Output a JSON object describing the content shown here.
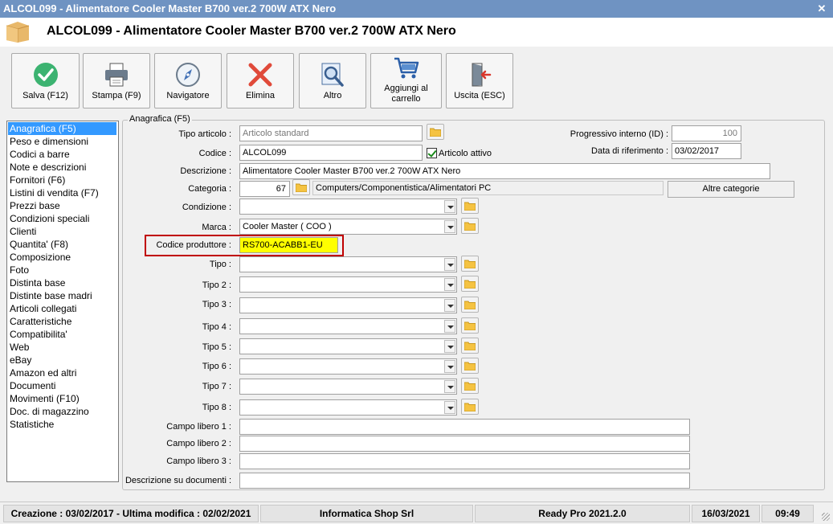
{
  "window": {
    "title": "ALCOL099 - Alimentatore Cooler Master B700 ver.2 700W ATX Nero"
  },
  "header": {
    "title": "ALCOL099 - Alimentatore Cooler Master B700 ver.2 700W ATX Nero"
  },
  "toolbar": {
    "save": "Salva (F12)",
    "print": "Stampa (F9)",
    "navigator": "Navigatore",
    "delete": "Elimina",
    "other": "Altro",
    "add_cart_1": "Aggiungi al",
    "add_cart_2": "carrello",
    "exit": "Uscita (ESC)"
  },
  "sidebar": {
    "items": [
      "Anagrafica (F5)",
      "Peso e dimensioni",
      "Codici a barre",
      "Note e descrizioni",
      "Fornitori (F6)",
      "Listini di vendita (F7)",
      "Prezzi base",
      "Condizioni speciali",
      "Clienti",
      "Quantita' (F8)",
      "Composizione",
      "Foto",
      "Distinta base",
      "Distinte base madri",
      "Articoli collegati",
      "Caratteristiche",
      "Compatibilita'",
      "Web",
      "eBay",
      "Amazon ed altri",
      "Documenti",
      "Movimenti (F10)",
      "Doc. di magazzino",
      "Statistiche"
    ],
    "selected": "Anagrafica (F5)"
  },
  "form": {
    "group_title": "Anagrafica (F5)",
    "tipo_articolo_label": "Tipo articolo :",
    "tipo_articolo_value": "Articolo standard",
    "codice_label": "Codice :",
    "codice_value": "ALCOL099",
    "articolo_attivo_label": "Articolo attivo",
    "descrizione_label": "Descrizione :",
    "descrizione_value": "Alimentatore Cooler Master B700 ver.2 700W ATX Nero",
    "categoria_label": "Categoria :",
    "categoria_id": "67",
    "categoria_path": "Computers/Componentistica/Alimentatori PC",
    "altre_categorie": "Altre categorie",
    "progressivo_label": "Progressivo interno (ID) :",
    "progressivo_value": "100",
    "data_rif_label": "Data di riferimento :",
    "data_rif_value": "03/02/2017",
    "condizione_label": "Condizione :",
    "marca_label": "Marca :",
    "marca_value": "Cooler Master ( COO )",
    "codice_produttore_label": "Codice produttore :",
    "codice_produttore_value": "RS700-ACABB1-EU",
    "tipo_label": "Tipo :",
    "tipo2_label": "Tipo 2 :",
    "tipo3_label": "Tipo 3 :",
    "tipo4_label": "Tipo 4 :",
    "tipo5_label": "Tipo 5 :",
    "tipo6_label": "Tipo 6 :",
    "tipo7_label": "Tipo 7 :",
    "tipo8_label": "Tipo 8 :",
    "campo1_label": "Campo libero 1 :",
    "campo2_label": "Campo libero 2 :",
    "campo3_label": "Campo libero 3 :",
    "desc_doc_label": "Descrizione su documenti :"
  },
  "status": {
    "dates": "Creazione : 03/02/2017 - Ultima modifica : 02/02/2021",
    "company": "Informatica Shop Srl",
    "app": "Ready Pro 2021.2.0",
    "date": "16/03/2021",
    "time": "09:49"
  },
  "colors": {
    "title_bar": "#6f93c2",
    "selection": "#3399ff",
    "highlight": "#ffff00",
    "annotation": "#c00000"
  }
}
